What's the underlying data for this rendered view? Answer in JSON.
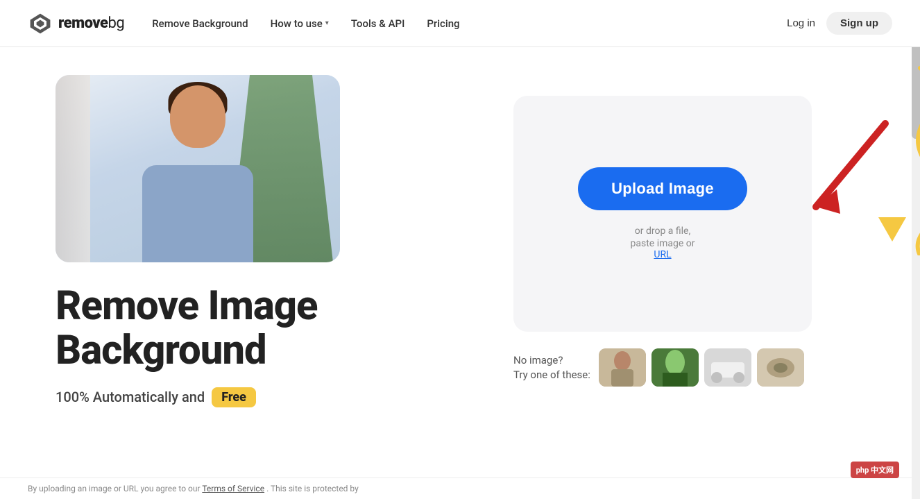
{
  "navbar": {
    "logo_text_bold": "remove",
    "logo_text_light": "bg",
    "nav_remove_bg": "Remove Background",
    "nav_how_to_use": "How to use",
    "nav_tools_api": "Tools & API",
    "nav_pricing": "Pricing",
    "login_label": "Log in",
    "signup_label": "Sign up"
  },
  "hero": {
    "headline_line1": "Remove Image",
    "headline_line2": "Background",
    "subtitle": "100% Automatically and",
    "free_badge": "Free"
  },
  "upload": {
    "upload_btn_label": "Upload Image",
    "drop_text": "or drop a file,",
    "paste_text": "paste image or",
    "url_label": "URL"
  },
  "samples": {
    "no_image_line1": "No image?",
    "no_image_line2": "Try one of these:"
  },
  "footer": {
    "text_before_link": "By uploading an image or URL you agree to our",
    "tos_link": "Terms of Service",
    "text_after": ". This site is protected by"
  }
}
